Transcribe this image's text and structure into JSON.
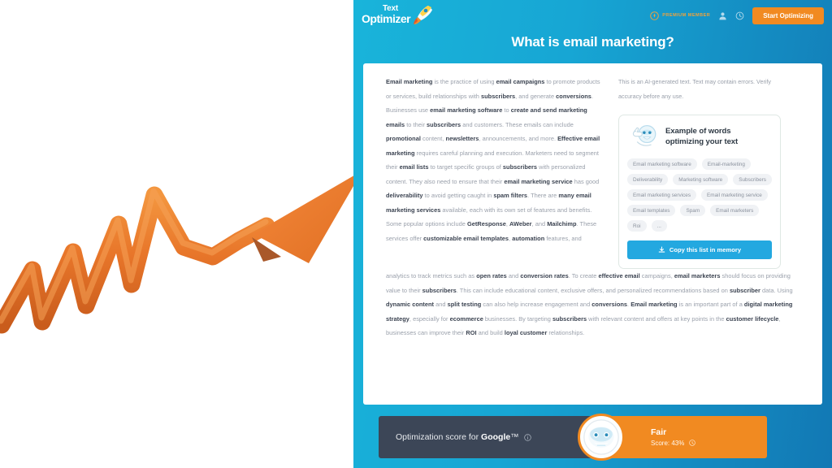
{
  "brand": {
    "name_top": "Text",
    "name_bottom": "Optimizer",
    "rocket_icon": "rocket-icon"
  },
  "header": {
    "premium_label": "PREMIUM MEMBER",
    "premium_icon": "premium-medal-icon",
    "account_icon": "user-account-icon",
    "help_icon": "help-clock-icon",
    "cta_label": "Start Optimizing"
  },
  "page": {
    "title": "What is email marketing?"
  },
  "article": {
    "narrow_html": "<b>Email marketing</b> is the practice of using <b>email campaigns</b> to promote products or services, build relationships with <b>subscribers</b>, and generate <b>conversions</b>. Businesses use <b>email marketing software</b> to <b>create and send marketing emails</b> to their <b>subscribers</b> and customers. These emails can include <b>promotional</b> content, <b>newsletters</b>, announcements, and more. <b>Effective email marketing</b> requires careful planning and execution. Marketers need to segment their <b>email lists</b> to target specific groups of <b>subscribers</b> with personalized content. They also need to ensure that their <b>email marketing service</b> has good <b>deliverability</b> to avoid getting caught in <b>spam filters</b>. There are <b>many email marketing services</b> available, each with its own set of features and benefits. Some popular options include <b>GetResponse</b>, <b>AWeber</b>, and <b>Mailchimp</b>. These services offer <b>customizable email templates</b>, <b>automation</b> features, and",
    "wide_html": "analytics to track metrics such as <b>open rates</b> and <b>conversion rates</b>. To create <b>effective email</b> campaigns, <b>email marketers</b> should focus on providing value to their <b>subscribers</b>. This can include educational content, exclusive offers, and personalized recommendations based on <b>subscriber</b> data. Using <b>dynamic content</b> and <b>split testing</b> can also help increase engagement and <b>conversions</b>. <b>Email marketing</b> is an important part of a <b>digital marketing strategy</b>, especially for <b>ecommerce</b> businesses. By targeting <b>subscribers</b> with relevant content and offers at key points in the <b>customer lifecycle</b>, businesses can improve their <b>ROI</b> and build <b>loyal customer</b> relationships."
  },
  "sidebar": {
    "ai_disclaimer": "This is an AI-generated text. Text may contain errors. Verify accuracy before any use.",
    "panel": {
      "mascot_icon": "robot-thumbs-up-icon",
      "title_line1": "Example of words",
      "title_line2": "optimizing your text",
      "tags": [
        "Email marketing software",
        "Email-marketing",
        "Deliverability",
        "Marketing software",
        "Subscribers",
        "Email marketing services",
        "Email marketing service",
        "Email templates",
        "Spam",
        "Email marketers",
        "Roi",
        "..."
      ],
      "copy_button_label": "Copy this list in memory",
      "copy_button_icon": "download-icon"
    }
  },
  "score_bar": {
    "label_prefix": "Optimization score for ",
    "label_engine": "Google",
    "label_suffix": "™",
    "label_info_icon": "info-icon",
    "mascot_icon": "robot-face-icon",
    "rating": "Fair",
    "score_text": "Score: 43%",
    "score_info_icon": "info-icon"
  },
  "decoration": {
    "arrow_icon": "orange-zigzag-growth-arrow"
  },
  "colors": {
    "header_gradient_start": "#19b4da",
    "header_gradient_end": "#1278b4",
    "accent_orange": "#f18a21",
    "accent_blue": "#23a8e0",
    "score_dark": "#3c4657",
    "premium_gold": "#f0a23c"
  }
}
